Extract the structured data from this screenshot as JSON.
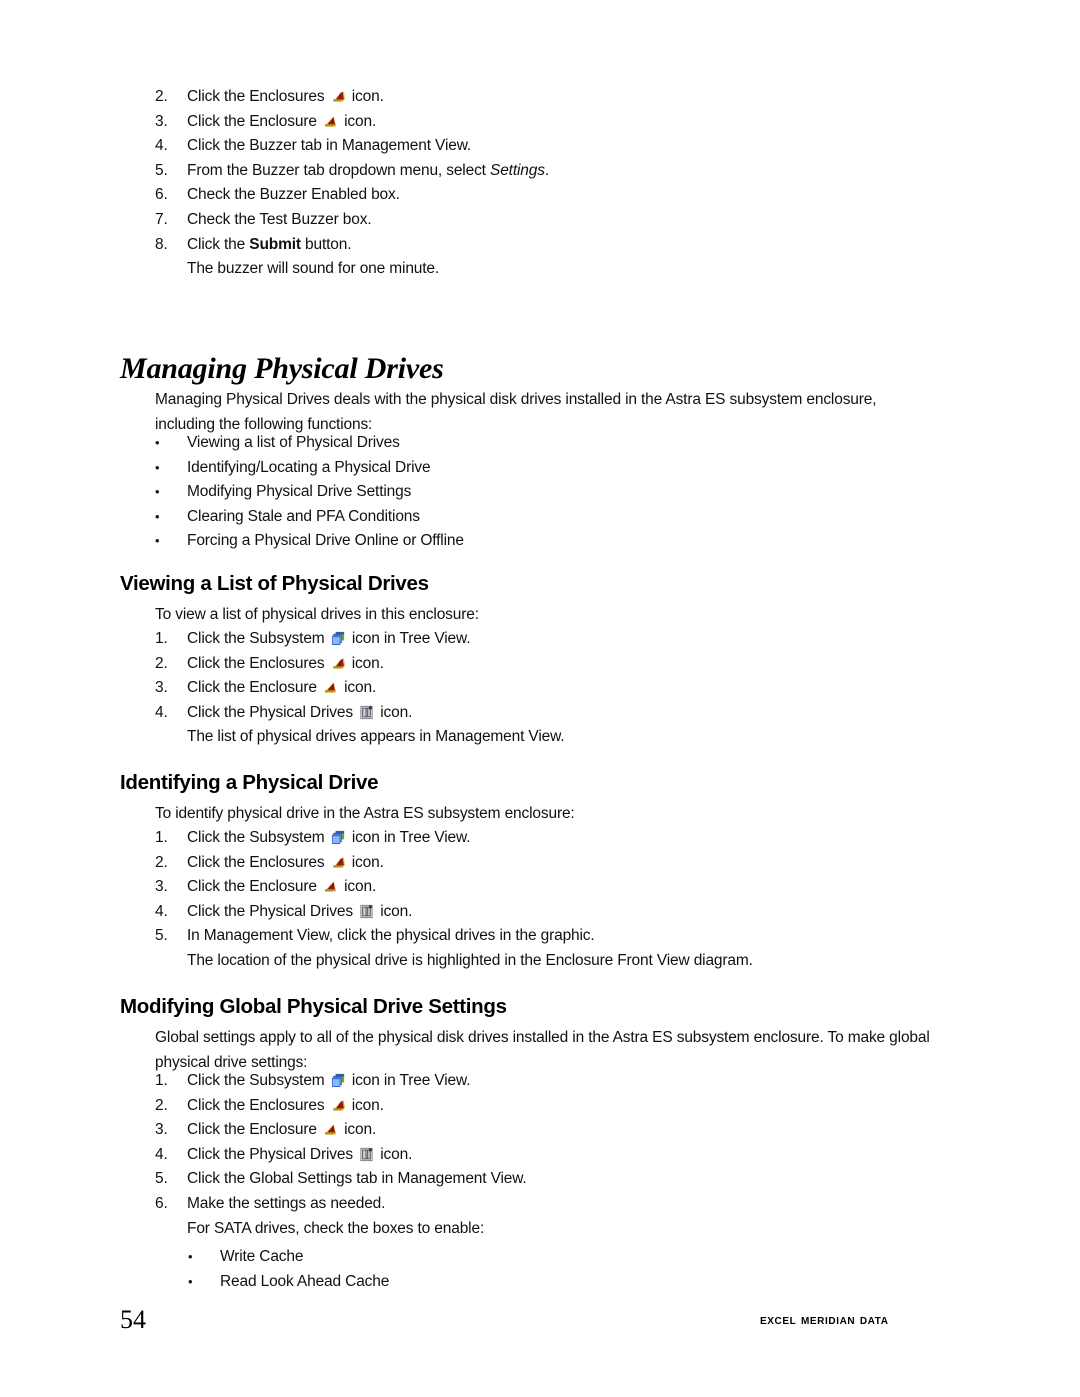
{
  "page": {
    "number": "54",
    "publisher": "Excel Meridian Data"
  },
  "icons": {
    "subsystem": "subsystem-icon",
    "enclosures": "enclosures-icon",
    "enclosure": "enclosure-icon",
    "physical_drives": "physical-drives-icon"
  },
  "buzzer_steps": {
    "items": [
      {
        "marker": "2.",
        "pre": "Click the Enclosures ",
        "icon": "enclosures",
        "post": " icon."
      },
      {
        "marker": "3.",
        "pre": "Click the Enclosure ",
        "icon": "enclosure",
        "post": " icon."
      },
      {
        "marker": "4.",
        "pre": "Click the Buzzer tab in Management View.",
        "icon": null,
        "post": ""
      },
      {
        "marker": "5.",
        "pre": "From the Buzzer tab dropdown menu, select ",
        "icon": null,
        "post": "",
        "italic": "Settings",
        "tail": "."
      },
      {
        "marker": "6.",
        "pre": "Check the Buzzer Enabled box.",
        "icon": null,
        "post": ""
      },
      {
        "marker": "7.",
        "pre": "Check the Test Buzzer box.",
        "icon": null,
        "post": ""
      },
      {
        "marker": "8.",
        "pre": "Click the ",
        "icon": null,
        "post": "",
        "bold": "Submit",
        "tail": " button."
      },
      {
        "marker": "",
        "pre": "The buzzer will sound for one minute.",
        "icon": null,
        "post": ""
      }
    ]
  },
  "managing": {
    "title": "Managing Physical Drives",
    "intro": "Managing Physical Drives deals with the physical disk drives installed in the Astra ES subsystem enclosure, including the following functions:",
    "bullets": [
      "Viewing a list of Physical Drives",
      "Identifying/Locating a Physical Drive",
      "Modifying Physical Drive Settings",
      "Clearing Stale and PFA Conditions",
      "Forcing a Physical Drive Online or Offline"
    ],
    "bullet_marker": "•"
  },
  "viewing": {
    "title": "Viewing a List of Physical Drives",
    "intro": "To view a list of physical drives in this enclosure:",
    "steps": [
      {
        "marker": "1.",
        "pre": "Click the Subsystem ",
        "icon": "subsystem",
        "post": " icon in Tree View."
      },
      {
        "marker": "2.",
        "pre": "Click the Enclosures ",
        "icon": "enclosures",
        "post": " icon."
      },
      {
        "marker": "3.",
        "pre": "Click the Enclosure ",
        "icon": "enclosure",
        "post": " icon."
      },
      {
        "marker": "4.",
        "pre": "Click the Physical Drives ",
        "icon": "physical_drives",
        "post": " icon."
      },
      {
        "marker": "",
        "pre": "The list of physical drives appears in Management View.",
        "icon": null,
        "post": ""
      }
    ]
  },
  "identifying": {
    "title": "Identifying a Physical Drive",
    "intro": "To identify physical drive in the Astra ES subsystem enclosure:",
    "steps": [
      {
        "marker": "1.",
        "pre": "Click the Subsystem ",
        "icon": "subsystem",
        "post": " icon in Tree View."
      },
      {
        "marker": "2.",
        "pre": "Click the Enclosures ",
        "icon": "enclosures",
        "post": " icon."
      },
      {
        "marker": "3.",
        "pre": "Click the Enclosure ",
        "icon": "enclosure",
        "post": " icon."
      },
      {
        "marker": "4.",
        "pre": "Click the Physical Drives ",
        "icon": "physical_drives",
        "post": " icon."
      },
      {
        "marker": "5.",
        "pre": "In Management View, click the physical drives in the graphic.",
        "icon": null,
        "post": ""
      },
      {
        "marker": "",
        "pre": "The location of the physical drive is highlighted in the Enclosure Front View diagram.",
        "icon": null,
        "post": ""
      }
    ]
  },
  "modifying": {
    "title": "Modifying Global Physical Drive Settings",
    "intro": "Global settings apply to all of the physical disk drives installed in the Astra ES subsystem enclosure. To make global physical drive settings:",
    "steps": [
      {
        "marker": "1.",
        "pre": "Click the Subsystem ",
        "icon": "subsystem",
        "post": " icon in Tree View."
      },
      {
        "marker": "2.",
        "pre": "Click the Enclosures ",
        "icon": "enclosures",
        "post": " icon."
      },
      {
        "marker": "3.",
        "pre": "Click the Enclosure ",
        "icon": "enclosure",
        "post": " icon."
      },
      {
        "marker": "4.",
        "pre": "Click the Physical Drives ",
        "icon": "physical_drives",
        "post": " icon."
      },
      {
        "marker": "5.",
        "pre": "Click the Global Settings tab in Management View.",
        "icon": null,
        "post": ""
      },
      {
        "marker": "6.",
        "pre": "Make the settings as needed.",
        "icon": null,
        "post": ""
      },
      {
        "marker": "",
        "pre": "For SATA drives, check the boxes to enable:",
        "icon": null,
        "post": ""
      }
    ],
    "sub_bullets": [
      "Write Cache",
      "Read Look Ahead Cache"
    ],
    "bullet_marker": "•"
  },
  "colors": {
    "enclosure_gold": "#E8B53C",
    "enclosure_dark_red": "#8C1A12",
    "subsystem_blue": "#3A6FD8",
    "subsystem_green": "#6FA82B",
    "drive_gray": "#9AA0A6",
    "text": "#111111"
  }
}
